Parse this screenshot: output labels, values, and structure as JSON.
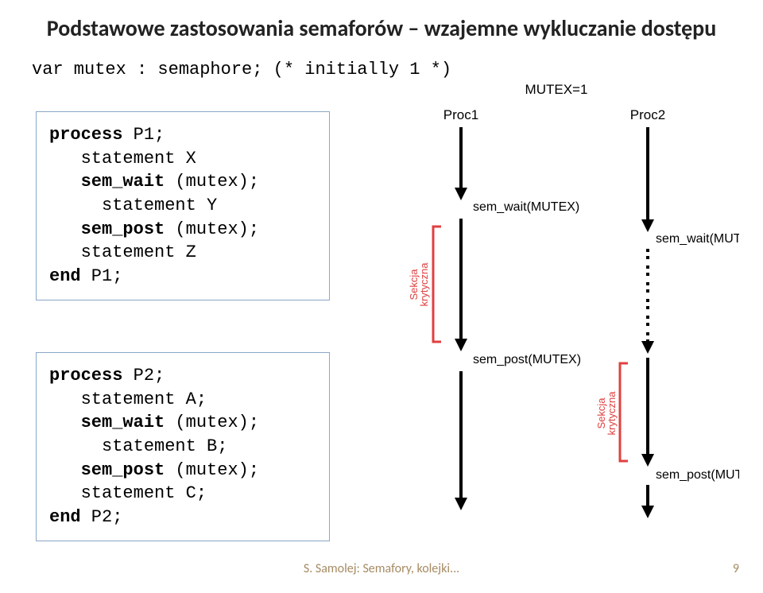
{
  "title": "Podstawowe zastosowania semaforów – wzajemne wykluczanie dostępu",
  "var_decl": "var mutex : semaphore; (* initially 1 *)",
  "code1": {
    "l1a": "process",
    "l1b": " P1;",
    "l2": "   statement X",
    "l3a": "   ",
    "l3b": "sem_wait",
    "l3c": " (mutex);",
    "l4": "     statement Y",
    "l5a": "   ",
    "l5b": "sem_post",
    "l5c": " (mutex);",
    "l6": "   statement Z",
    "l7a": "end",
    "l7b": " P1;"
  },
  "code2": {
    "l1a": "process",
    "l1b": " P2;",
    "l2": "   statement A;",
    "l3a": "   ",
    "l3b": "sem_wait",
    "l3c": " (mutex);",
    "l4": "     statement B;",
    "l5a": "   ",
    "l5b": "sem_post",
    "l5c": " (mutex);",
    "l6": "   statement C;",
    "l7a": "end",
    "l7b": " P2;"
  },
  "diagram": {
    "mutex": "MUTEX=1",
    "proc1": "Proc1",
    "proc2": "Proc2",
    "sw": "sem_wait(MUTEX)",
    "sp": "sem_post(MUTEX)",
    "crit": "Sekcja",
    "crit2": "krytyczna"
  },
  "footer": "S. Samolej: Semafory, kolejki...",
  "pagenum": "9"
}
